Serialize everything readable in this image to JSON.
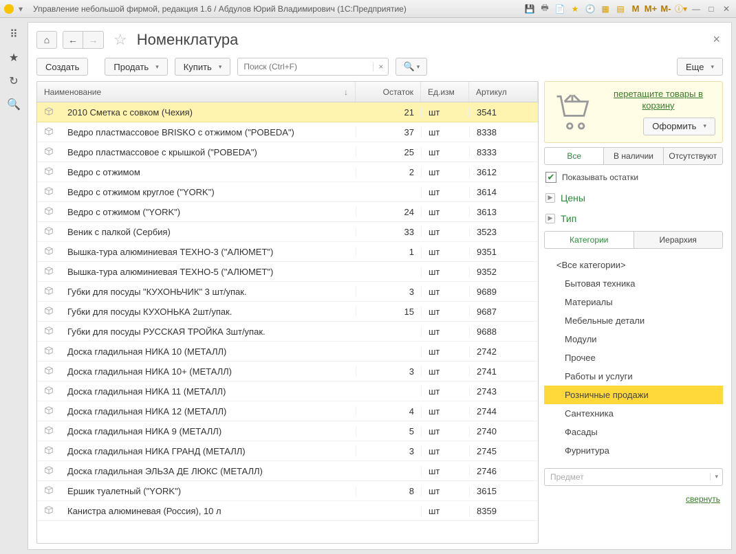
{
  "titlebar": {
    "title": "Управление небольшой фирмой, редакция 1.6 / Абдулов Юрий Владимирович  (1С:Предприятие)",
    "m_labels": [
      "M",
      "M+",
      "M-"
    ]
  },
  "page": {
    "title": "Номенклатура"
  },
  "toolbar": {
    "create": "Создать",
    "sell": "Продать",
    "buy": "Купить",
    "search_placeholder": "Поиск (Ctrl+F)",
    "more": "Еще"
  },
  "table": {
    "cols": {
      "name": "Наименование",
      "qty": "Остаток",
      "unit": "Ед.изм",
      "art": "Артикул"
    },
    "rows": [
      {
        "name": "2010 Сметка с совком (Чехия)",
        "qty": "21",
        "unit": "шт",
        "art": "3541",
        "sel": true
      },
      {
        "name": "Ведро пластмассовое BRISKO с отжимом (\"POBEDA\")",
        "qty": "37",
        "unit": "шт",
        "art": "8338"
      },
      {
        "name": "Ведро пластмассовое с крышкой (\"POBEDA\")",
        "qty": "25",
        "unit": "шт",
        "art": "8333"
      },
      {
        "name": "Ведро с отжимом",
        "qty": "2",
        "unit": "шт",
        "art": "3612"
      },
      {
        "name": "Ведро с отжимом  круглое (\"YORK\")",
        "qty": "",
        "unit": "шт",
        "art": "3614"
      },
      {
        "name": "Ведро с отжимом (\"YORK\")",
        "qty": "24",
        "unit": "шт",
        "art": "3613"
      },
      {
        "name": "Веник с палкой (Сербия)",
        "qty": "33",
        "unit": "шт",
        "art": "3523"
      },
      {
        "name": "Вышка-тура алюминиевая ТЕХНО-3 (\"АЛЮМЕТ\")",
        "qty": "1",
        "unit": "шт",
        "art": "9351"
      },
      {
        "name": "Вышка-тура алюминиевая ТЕХНО-5 (\"АЛЮМЕТ\")",
        "qty": "",
        "unit": "шт",
        "art": "9352"
      },
      {
        "name": "Губки для посуды \"КУХОНЬЧИК\" 3 шт/упак.",
        "qty": "3",
        "unit": "шт",
        "art": "9689"
      },
      {
        "name": "Губки для посуды КУХОНЬКА 2шт/упак.",
        "qty": "15",
        "unit": "шт",
        "art": "9687"
      },
      {
        "name": "Губки для посуды РУССКАЯ ТРОЙКА 3шт/упак.",
        "qty": "",
        "unit": "шт",
        "art": "9688"
      },
      {
        "name": "Доска гладильная  НИКА 10 (МЕТАЛЛ)",
        "qty": "",
        "unit": "шт",
        "art": "2742"
      },
      {
        "name": "Доска гладильная  НИКА 10+ (МЕТАЛЛ)",
        "qty": "3",
        "unit": "шт",
        "art": "2741"
      },
      {
        "name": "Доска гладильная  НИКА 11 (МЕТАЛЛ)",
        "qty": "",
        "unit": "шт",
        "art": "2743"
      },
      {
        "name": "Доска гладильная  НИКА 12 (МЕТАЛЛ)",
        "qty": "4",
        "unit": "шт",
        "art": "2744"
      },
      {
        "name": "Доска гладильная  НИКА 9 (МЕТАЛЛ)",
        "qty": "5",
        "unit": "шт",
        "art": "2740"
      },
      {
        "name": "Доска гладильная  НИКА ГРАНД (МЕТАЛЛ)",
        "qty": "3",
        "unit": "шт",
        "art": "2745"
      },
      {
        "name": "Доска гладильная  ЭЛЬЗА ДЕ ЛЮКС (МЕТАЛЛ)",
        "qty": "",
        "unit": "шт",
        "art": "2746"
      },
      {
        "name": "Ершик туалетный (\"YORK\")",
        "qty": "8",
        "unit": "шт",
        "art": "3615"
      },
      {
        "name": "Канистра алюминевая (Россия), 10 л",
        "qty": "",
        "unit": "шт",
        "art": "8359"
      }
    ]
  },
  "side": {
    "cart_hint": "перетащите товары в корзину",
    "checkout": "Оформить",
    "filter_tabs": [
      "Все",
      "В наличии",
      "Отсутствуют"
    ],
    "filter_active": 0,
    "show_qty": "Показывать остатки",
    "prices": "Цены",
    "type": "Тип",
    "view_tabs": [
      "Категории",
      "Иерархия"
    ],
    "view_active": 0,
    "categories": [
      {
        "label": "<Все категории>",
        "lvl": 0
      },
      {
        "label": "Бытовая техника",
        "lvl": 1
      },
      {
        "label": "Материалы",
        "lvl": 1
      },
      {
        "label": "Мебельные детали",
        "lvl": 1
      },
      {
        "label": "Модули",
        "lvl": 1
      },
      {
        "label": "Прочее",
        "lvl": 1
      },
      {
        "label": "Работы и услуги",
        "lvl": 1
      },
      {
        "label": "Розничные продажи",
        "lvl": 1,
        "sel": true
      },
      {
        "label": "Сантехника",
        "lvl": 1
      },
      {
        "label": "Фасады",
        "lvl": 1
      },
      {
        "label": "Фурнитура",
        "lvl": 1
      }
    ],
    "combo_placeholder": "Предмет",
    "collapse": "свернуть"
  }
}
